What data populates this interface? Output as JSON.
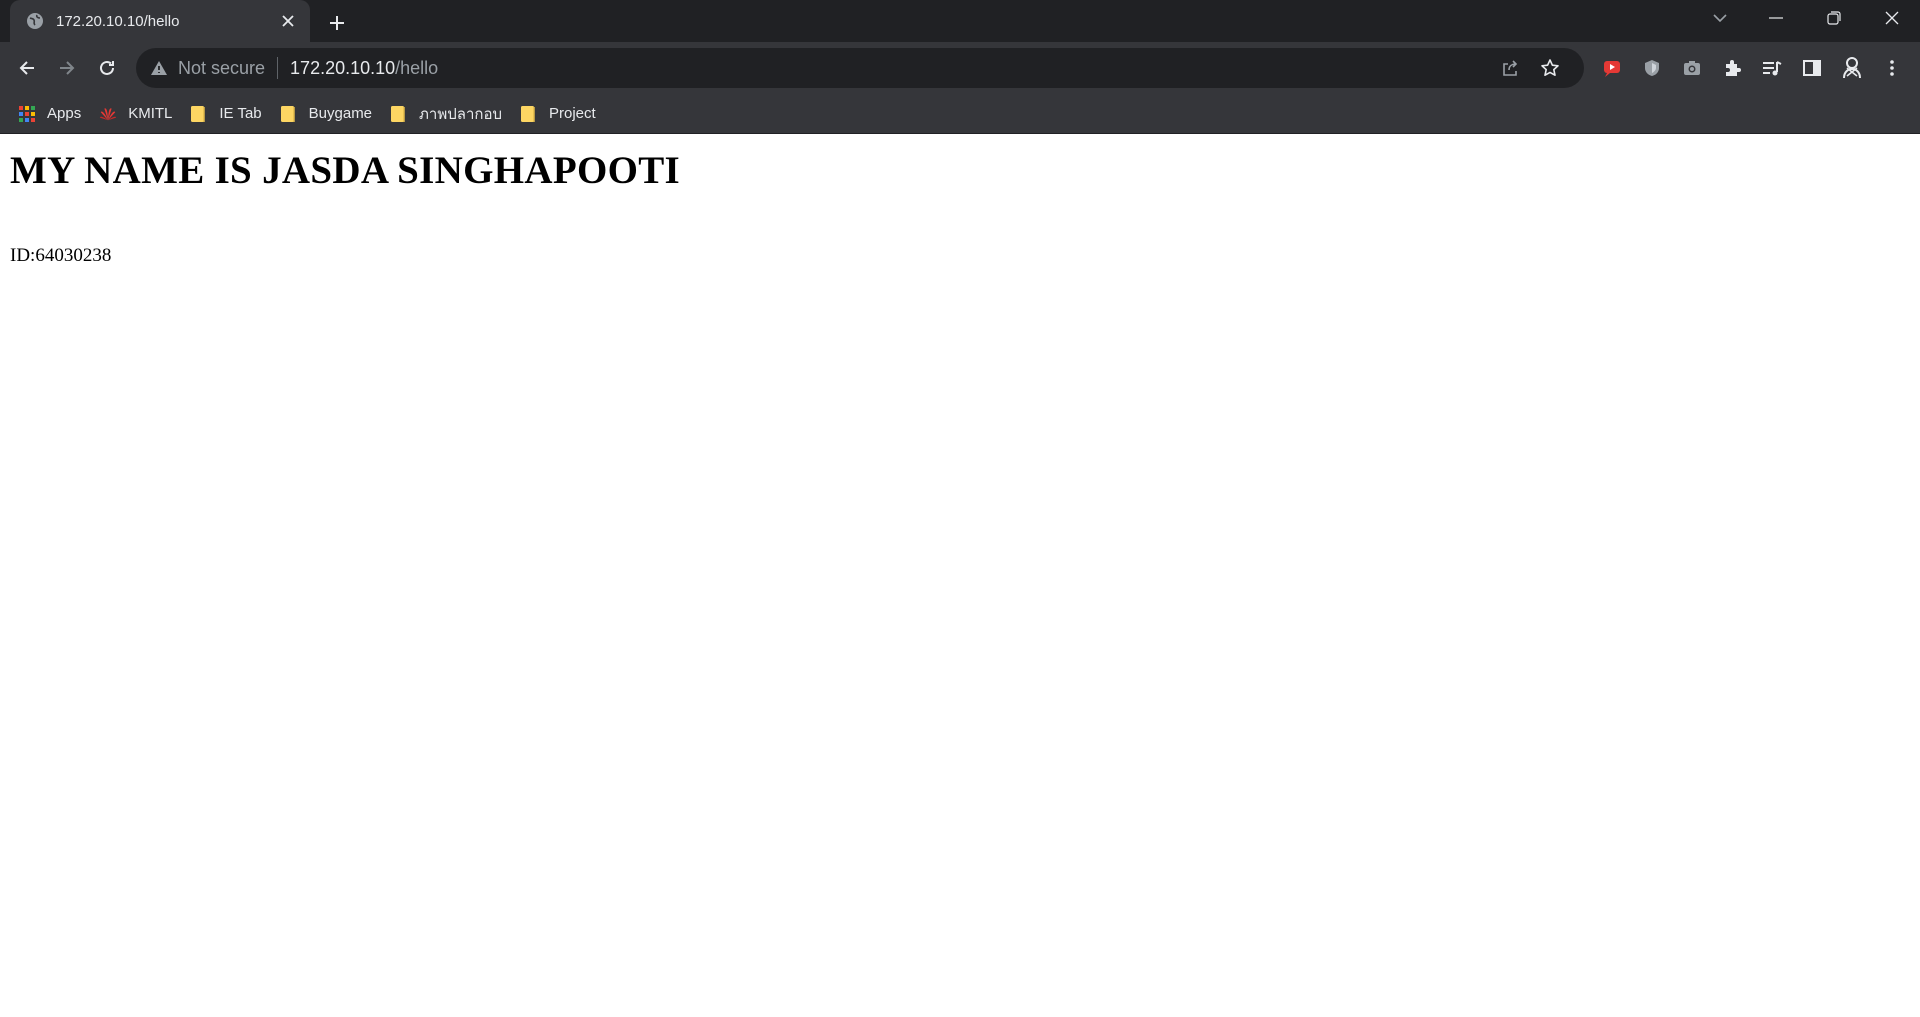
{
  "tab": {
    "title": "172.20.10.10/hello"
  },
  "omnibox": {
    "security_label": "Not secure",
    "host": "172.20.10.10",
    "path": "/hello"
  },
  "bookmarks": [
    {
      "label": "Apps",
      "icon": "apps-grid-icon"
    },
    {
      "label": "KMITL",
      "icon": "huawei-logo-icon"
    },
    {
      "label": "IE Tab",
      "icon": "folder-icon"
    },
    {
      "label": "Buygame",
      "icon": "folder-icon"
    },
    {
      "label": "ภาพปลากอบ",
      "icon": "folder-icon"
    },
    {
      "label": "Project",
      "icon": "folder-icon"
    }
  ],
  "page": {
    "heading": "MY NAME IS JASDA SINGHAPOOTI",
    "id_text": "ID:64030238"
  },
  "colors": {
    "chrome_dark": "#202124",
    "chrome_toolbar": "#35363a",
    "folder_yellow": "#fdd663"
  }
}
